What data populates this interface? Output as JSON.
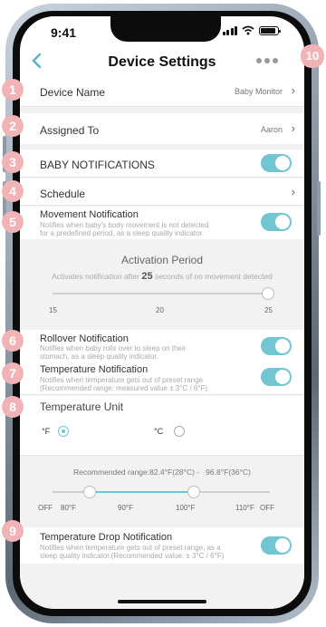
{
  "status": {
    "time": "9:41"
  },
  "header": {
    "back_icon": "chevron-left-icon",
    "title": "Device Settings",
    "more_icon": "more-dots-icon"
  },
  "settings": {
    "device_name": {
      "label": "Device Name",
      "value": "Baby Monitor"
    },
    "assigned_to": {
      "label": "Assigned To",
      "value": "Aaron"
    },
    "baby_notifications": {
      "label": "BABY NOTIFICATIONS",
      "enabled": true
    },
    "schedule": {
      "label": "Schedule"
    },
    "movement": {
      "label": "Movement Notification",
      "desc1": "Notifies when baby's body movement is not detected",
      "desc2": "for a predefined period, as a sleep quality indicator.",
      "enabled": true
    },
    "activation": {
      "title": "Activation Period",
      "desc_prefix": "Activates notification after",
      "seconds": "25",
      "desc_suffix": "seconds of no movement detected",
      "ticks": [
        "15",
        "20",
        "25"
      ],
      "value": 25
    },
    "rollover": {
      "label": "Rollover Notification",
      "desc1": "Notifies when baby rolls over to sleep on their",
      "desc2": "stomach, as a sleep quality indicator.",
      "enabled": true
    },
    "temperature": {
      "label": "Temperature Notification",
      "desc1": "Notifies when temperature gets out of preset range",
      "desc2": "(Recommended range: measured value ± 3°C / 6°F)",
      "enabled": true
    },
    "temp_unit": {
      "label": "Temperature Unit",
      "f_label": "°F",
      "c_label": "°C",
      "selected": "F"
    },
    "range": {
      "label": "Recommended range:82.4°F(28°C) -   96.8°F(36°C)",
      "ticks": [
        "OFF",
        "80°F",
        "90°F",
        "100°F",
        "110°F",
        "OFF"
      ],
      "low": 82.4,
      "high": 96.8
    },
    "temp_drop": {
      "label": "Temperature Drop Notification",
      "desc1": "Notifies when temperature gets out of preset range, as a",
      "desc2": "sleep quality indicator.(Recommended value: ± 3°C / 6°F)",
      "enabled": true
    }
  },
  "badges": [
    "1",
    "2",
    "3",
    "4",
    "5",
    "6",
    "7",
    "8",
    "9",
    "10"
  ],
  "colors": {
    "accent": "#72c6d2",
    "badge": "#f2b3b6"
  }
}
